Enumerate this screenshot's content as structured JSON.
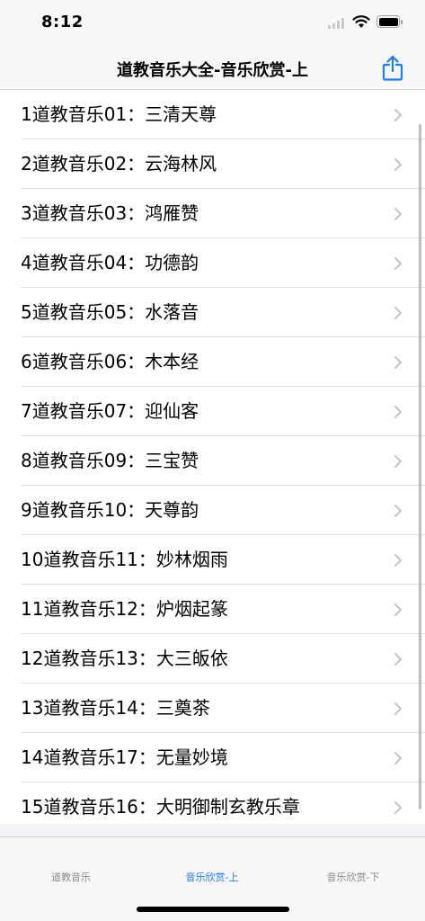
{
  "status_bar": {
    "time": "8:12"
  },
  "nav": {
    "title": "道教音乐大全-音乐欣赏-上",
    "share_icon": "share-icon"
  },
  "colors": {
    "accent": "#1d7cf2",
    "inactive_tab": "#8a8a8e",
    "separator": "#e0e0e0",
    "chevron": "#c4c4c7"
  },
  "list": {
    "items": [
      {
        "label": "1道教音乐01：三清天尊"
      },
      {
        "label": "2道教音乐02：云海林风"
      },
      {
        "label": "3道教音乐03：鸿雁赞"
      },
      {
        "label": "4道教音乐04：功德韵"
      },
      {
        "label": "5道教音乐05：水落音"
      },
      {
        "label": "6道教音乐06：木本经"
      },
      {
        "label": "7道教音乐07：迎仙客"
      },
      {
        "label": "8道教音乐09：三宝赞"
      },
      {
        "label": "9道教音乐10：天尊韵"
      },
      {
        "label": "10道教音乐11：妙林烟雨"
      },
      {
        "label": "11道教音乐12：炉烟起篆"
      },
      {
        "label": "12道教音乐13：大三皈依"
      },
      {
        "label": "13道教音乐14：三奠茶"
      },
      {
        "label": "14道教音乐17：无量妙境"
      },
      {
        "label": "15道教音乐16：大明御制玄教乐章"
      }
    ]
  },
  "tabs": [
    {
      "label": "道教音乐",
      "active": false
    },
    {
      "label": "音乐欣赏-上",
      "active": true
    },
    {
      "label": "音乐欣赏-下",
      "active": false
    }
  ]
}
